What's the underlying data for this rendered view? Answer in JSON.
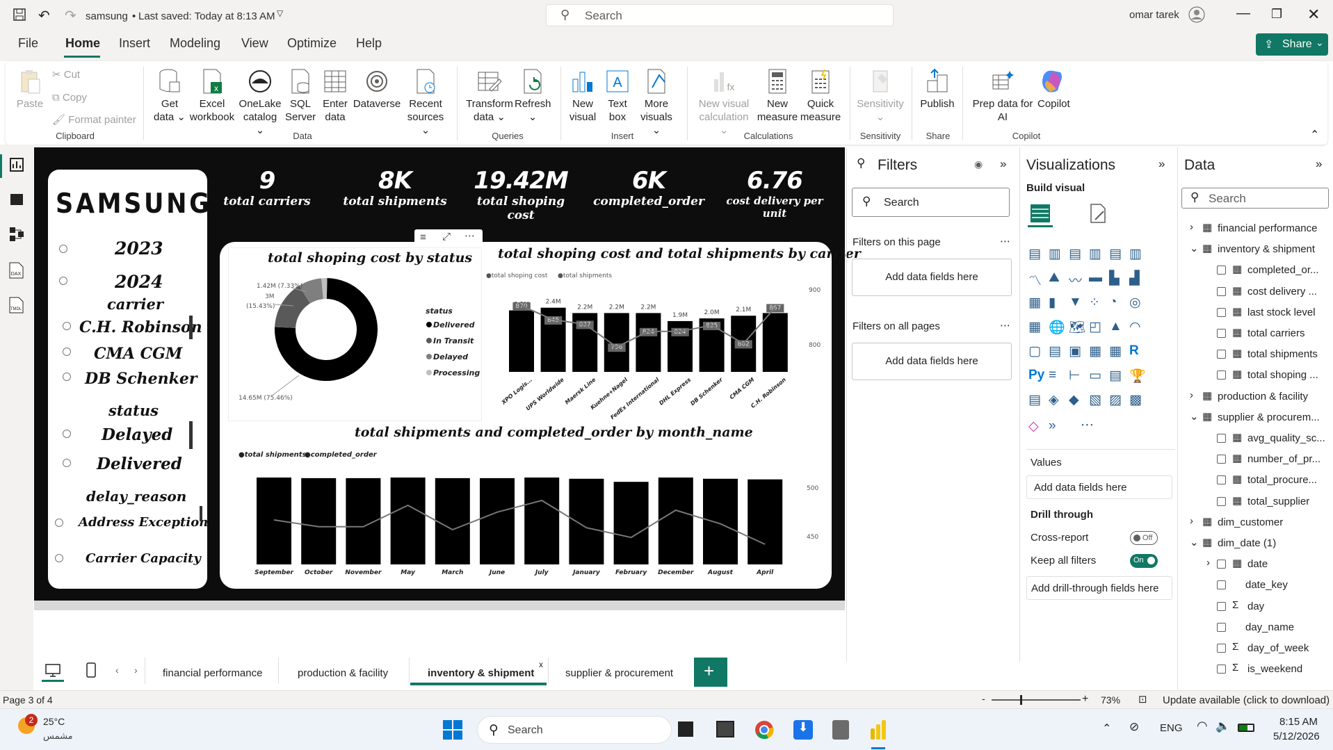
{
  "titlebar": {
    "filename": "samsung",
    "saved": "Last saved: Today at 8:13 AM",
    "search": "Search",
    "user": "omar tarek"
  },
  "menu": {
    "items": [
      "File",
      "Home",
      "Insert",
      "Modeling",
      "View",
      "Optimize",
      "Help"
    ],
    "share": "Share"
  },
  "ribbon": {
    "paste": "Paste",
    "cut": "Cut",
    "copy": "Copy",
    "format_painter": "Format painter",
    "get_data": [
      "Get",
      "data ⌄"
    ],
    "excel": [
      "Excel",
      "workbook"
    ],
    "onelake": [
      "OneLake",
      "catalog ⌄"
    ],
    "sql": [
      "SQL",
      "Server"
    ],
    "enter": [
      "Enter",
      "data"
    ],
    "dataverse": [
      "Dataverse",
      ""
    ],
    "recent": [
      "Recent",
      "sources ⌄"
    ],
    "transform": [
      "Transform",
      "data ⌄"
    ],
    "refresh": [
      "Refresh",
      "⌄"
    ],
    "new_visual": [
      "New",
      "visual"
    ],
    "text_box": [
      "Text",
      "box"
    ],
    "more_visuals": [
      "More",
      "visuals ⌄"
    ],
    "new_visual_calc": [
      "New visual",
      "calculation ⌄"
    ],
    "new_measure": [
      "New",
      "measure"
    ],
    "quick_measure": [
      "Quick",
      "measure"
    ],
    "sensitivity": [
      "Sensitivity",
      "⌄"
    ],
    "publish": [
      "Publish",
      ""
    ],
    "prep": [
      "Prep data for",
      "AI"
    ],
    "copilot": [
      "Copilot",
      ""
    ],
    "groups": [
      "Clipboard",
      "Data",
      "Queries",
      "Insert",
      "Calculations",
      "Sensitivity",
      "Share",
      "Copilot"
    ]
  },
  "kpis": [
    {
      "value": "9",
      "label": "total carriers"
    },
    {
      "value": "8K",
      "label": "total shipments"
    },
    {
      "value": "19.42M",
      "label": "total shoping cost"
    },
    {
      "value": "6K",
      "label": "completed_order"
    },
    {
      "value": "6.76",
      "label": "cost delivery per unit"
    }
  ],
  "slicer": {
    "brand": "SAMSUNG",
    "years": [
      "2023",
      "2024"
    ],
    "carrier_title": "carrier",
    "carriers": [
      "C.H. Robinson",
      "CMA CGM",
      "DB Schenker"
    ],
    "status_title": "status",
    "statuses": [
      "Delayed",
      "Delivered"
    ],
    "delay_title": "delay_reason",
    "delays": [
      "Address Exception",
      "Carrier Capacity"
    ]
  },
  "chart_data": [
    {
      "type": "pie",
      "title": "total shoping cost by status",
      "legend_title": "status",
      "categories": [
        "Delivered",
        "In Transit",
        "Delayed",
        "Processing"
      ],
      "values": [
        14.65,
        3.0,
        1.42,
        0.35
      ],
      "labels": [
        "14.65M (75.46%)",
        "3M (15.43%)",
        "1.42M (7.33%)"
      ],
      "colors": [
        "#000000",
        "#595959",
        "#7f7f7f",
        "#bfbfbf"
      ]
    },
    {
      "type": "bar",
      "title": "total shoping cost and total shipments by carrier",
      "categories": [
        "XPO Logis...",
        "UPS Worldwide",
        "Maersk Line",
        "Kuehne+Nagel",
        "FedEx International",
        "DHL Express",
        "DB Schenker",
        "CMA CGM",
        "C.H. Robinson"
      ],
      "series": [
        {
          "name": "total shoping cost",
          "values": [
            2.3,
            2.4,
            2.2,
            2.2,
            2.2,
            1.9,
            2.0,
            2.1,
            2.2
          ],
          "labels": [
            "2.3M",
            "2.4M",
            "2.2M",
            "2.2M",
            "2.2M",
            "1.9M",
            "2.0M",
            "2.1M",
            "2.2M"
          ]
        },
        {
          "name": "total shipments",
          "values": [
            870,
            845,
            837,
            796,
            824,
            824,
            835,
            802,
            867
          ]
        }
      ],
      "y2ticks": [
        "900",
        "800"
      ]
    },
    {
      "type": "bar",
      "title": "total shipments and completed_order by month_name",
      "categories": [
        "September",
        "October",
        "November",
        "May",
        "March",
        "June",
        "July",
        "January",
        "February",
        "December",
        "August",
        "April"
      ],
      "series": [
        {
          "name": "total shipments",
          "values": [
            705,
            700,
            700,
            705,
            700,
            700,
            705,
            695,
            670,
            705,
            695,
            690
          ]
        },
        {
          "name": "completed_order",
          "values": [
            470,
            463,
            463,
            485,
            460,
            478,
            490,
            462,
            452,
            480,
            466,
            445
          ]
        }
      ],
      "y2ticks": [
        "500",
        "450"
      ]
    }
  ],
  "filters": {
    "title": "Filters",
    "search": "Search",
    "this_page": "Filters on this page",
    "all_pages": "Filters on all pages",
    "add": "Add data fields here"
  },
  "viz": {
    "title": "Visualizations",
    "build": "Build visual",
    "values": "Values",
    "add_values": "Add data fields here",
    "drill": "Drill through",
    "cross": "Cross-report",
    "off": "Off",
    "keep": "Keep all filters",
    "on": "On",
    "add_drill": "Add drill-through fields here"
  },
  "data": {
    "title": "Data",
    "search": "Search",
    "items": [
      {
        "level": 0,
        "label": "financial performance",
        "arrow": "›",
        "kind": "table"
      },
      {
        "level": 0,
        "label": "inventory & shipment",
        "arrow": "⌄",
        "kind": "table"
      },
      {
        "level": 1,
        "label": "completed_or...",
        "kind": "measure"
      },
      {
        "level": 1,
        "label": "cost delivery ...",
        "kind": "measure"
      },
      {
        "level": 1,
        "label": "last stock level",
        "kind": "measure"
      },
      {
        "level": 1,
        "label": "total carriers",
        "kind": "measure"
      },
      {
        "level": 1,
        "label": "total shipments",
        "kind": "measure"
      },
      {
        "level": 1,
        "label": "total shoping ...",
        "kind": "measure"
      },
      {
        "level": 0,
        "label": "production & facility",
        "arrow": "›",
        "kind": "table"
      },
      {
        "level": 0,
        "label": "supplier & procurem...",
        "arrow": "⌄",
        "kind": "table"
      },
      {
        "level": 1,
        "label": "avg_quality_sc...",
        "kind": "measure"
      },
      {
        "level": 1,
        "label": "number_of_pr...",
        "kind": "measure"
      },
      {
        "level": 1,
        "label": "total_procure...",
        "kind": "measure"
      },
      {
        "level": 1,
        "label": "total_supplier",
        "kind": "measure"
      },
      {
        "level": 0,
        "label": "dim_customer",
        "arrow": "›",
        "kind": "table"
      },
      {
        "level": 0,
        "label": "dim_date (1)",
        "arrow": "⌄",
        "kind": "table"
      },
      {
        "level": 1,
        "label": "date",
        "arrow": "›",
        "kind": "date"
      },
      {
        "level": 1,
        "label": "date_key",
        "kind": "field"
      },
      {
        "level": 1,
        "label": "day",
        "kind": "sum"
      },
      {
        "level": 1,
        "label": "day_name",
        "kind": "field"
      },
      {
        "level": 1,
        "label": "day_of_week",
        "kind": "sum"
      },
      {
        "level": 1,
        "label": "is_weekend",
        "kind": "sum"
      }
    ]
  },
  "tabs": [
    "financial performance",
    "production & facility",
    "inventory & shipment",
    "supplier & procurement"
  ],
  "status": {
    "page": "Page 3 of 4",
    "zoom": "73%",
    "update": "Update available (click to download)"
  },
  "taskbar": {
    "temp": "25°C",
    "weather": "مشمس",
    "badge": "2",
    "search": "Search",
    "lang": "ENG",
    "time": "8:15 AM",
    "date": "5/12/2026"
  }
}
